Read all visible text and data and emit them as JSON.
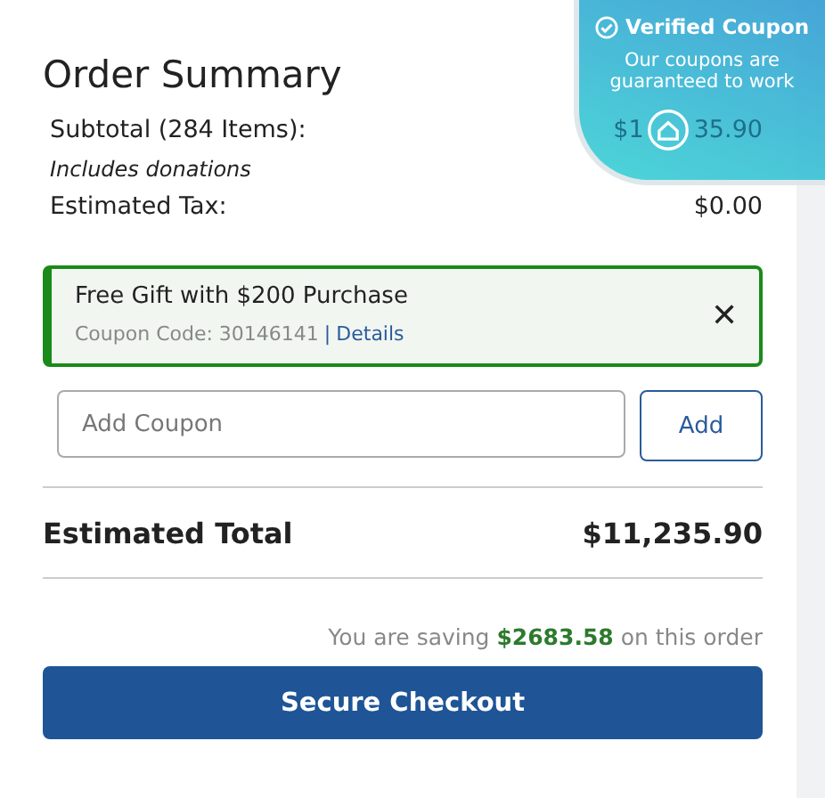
{
  "title": "Order Summary",
  "lines": [
    {
      "label": "Subtotal (284 Items):",
      "value_parts": [
        "$1",
        "35.90"
      ],
      "note": "Includes donations"
    },
    {
      "label": "Estimated Tax:",
      "value": "$0.00"
    }
  ],
  "coupon": {
    "title": "Free Gift with $200 Purchase",
    "code": "Coupon Code: 30146141",
    "separator": "|",
    "link": "Details",
    "close": "✕"
  },
  "coupon_field": {
    "placeholder": "Add Coupon",
    "button": "Add"
  },
  "total": {
    "label": "Estimated Total",
    "value": "$11,235.90"
  },
  "saving": {
    "before": "You are saving",
    "amount": "$2683.58",
    "after": "on this order"
  },
  "checkout": "Secure Checkout",
  "badge": {
    "title": "Verified Coupon",
    "text": "Our coupons are guaranteed to work"
  }
}
